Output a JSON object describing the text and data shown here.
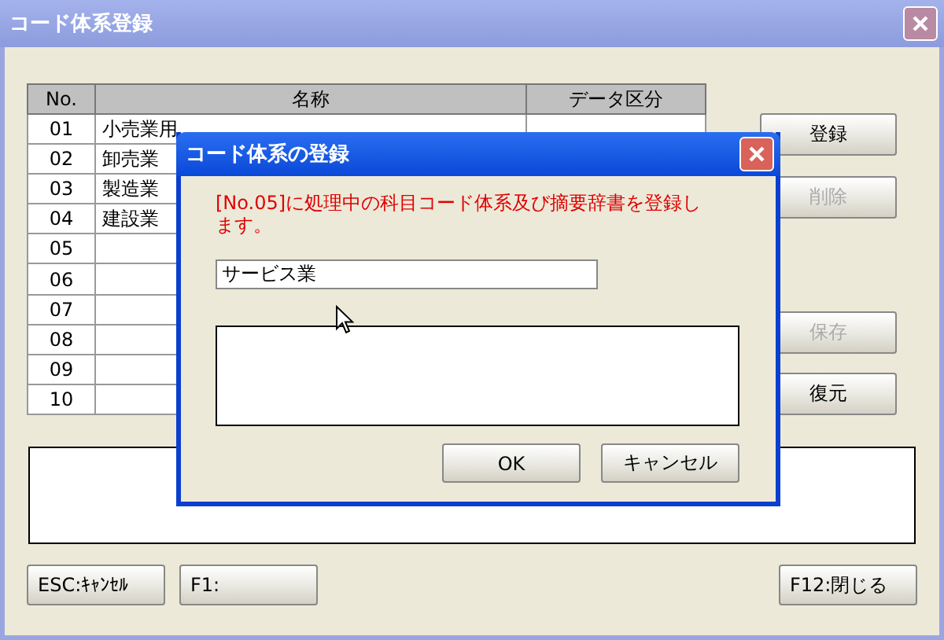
{
  "window": {
    "title": "コード体系登録"
  },
  "table": {
    "columns": [
      "No.",
      "名称",
      "データ区分"
    ],
    "rows": [
      {
        "no": "01",
        "name": "小売業用"
      },
      {
        "no": "02",
        "name": "卸売業"
      },
      {
        "no": "03",
        "name": "製造業"
      },
      {
        "no": "04",
        "name": "建設業"
      },
      {
        "no": "05"
      },
      {
        "no": "06"
      },
      {
        "no": "07"
      },
      {
        "no": "08"
      },
      {
        "no": "09"
      },
      {
        "no": "10"
      }
    ]
  },
  "side_buttons": [
    {
      "label": "登録",
      "disabled": false
    },
    {
      "label": "削除",
      "disabled": true
    },
    {
      "label": "保存",
      "disabled": true
    },
    {
      "label": "復元",
      "disabled": false
    }
  ],
  "footer_left_buttons": [
    "ESC:ｷｬﾝｾﾙ",
    "F1:"
  ],
  "footer_right_buttons": [
    "F12:閉じる"
  ],
  "dialog": {
    "title": "コード体系の登録",
    "message": "[No.05]に処理中の科目コード体系及び摘要辞書を登録します。",
    "name_value": "サービス業",
    "buttons": [
      "OK",
      "キャンセル"
    ]
  }
}
